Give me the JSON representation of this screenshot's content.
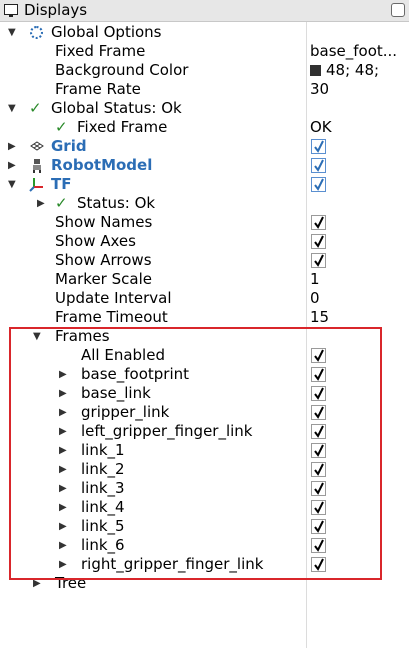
{
  "panel": {
    "title": "Displays"
  },
  "global_options": {
    "label": "Global Options",
    "fixed_frame_label": "Fixed Frame",
    "fixed_frame_value": "base_foot...",
    "bg_color_label": "Background Color",
    "bg_color_value": "48; 48;",
    "frame_rate_label": "Frame Rate",
    "frame_rate_value": "30"
  },
  "global_status": {
    "label": "Global Status: Ok",
    "fixed_frame_label": "Fixed Frame",
    "fixed_frame_value": "OK"
  },
  "grid": {
    "label": "Grid",
    "checked": true
  },
  "robot_model": {
    "label": "RobotModel",
    "checked": true
  },
  "tf": {
    "label": "TF",
    "checked": true,
    "status_label": "Status: Ok",
    "show_names_label": "Show Names",
    "show_axes_label": "Show Axes",
    "show_arrows_label": "Show Arrows",
    "marker_scale_label": "Marker Scale",
    "marker_scale_value": "1",
    "update_interval_label": "Update Interval",
    "update_interval_value": "0",
    "frame_timeout_label": "Frame Timeout",
    "frame_timeout_value": "15",
    "frames_label": "Frames",
    "all_enabled_label": "All Enabled",
    "frames": [
      "base_footprint",
      "base_link",
      "gripper_link",
      "left_gripper_finger_link",
      "link_1",
      "link_2",
      "link_3",
      "link_4",
      "link_5",
      "link_6",
      "right_gripper_finger_link"
    ],
    "tree_label": "Tree"
  },
  "colors": {
    "accent": "#2b6db5",
    "highlight": "#d9262b",
    "status_ok": "#2a8a2a"
  }
}
